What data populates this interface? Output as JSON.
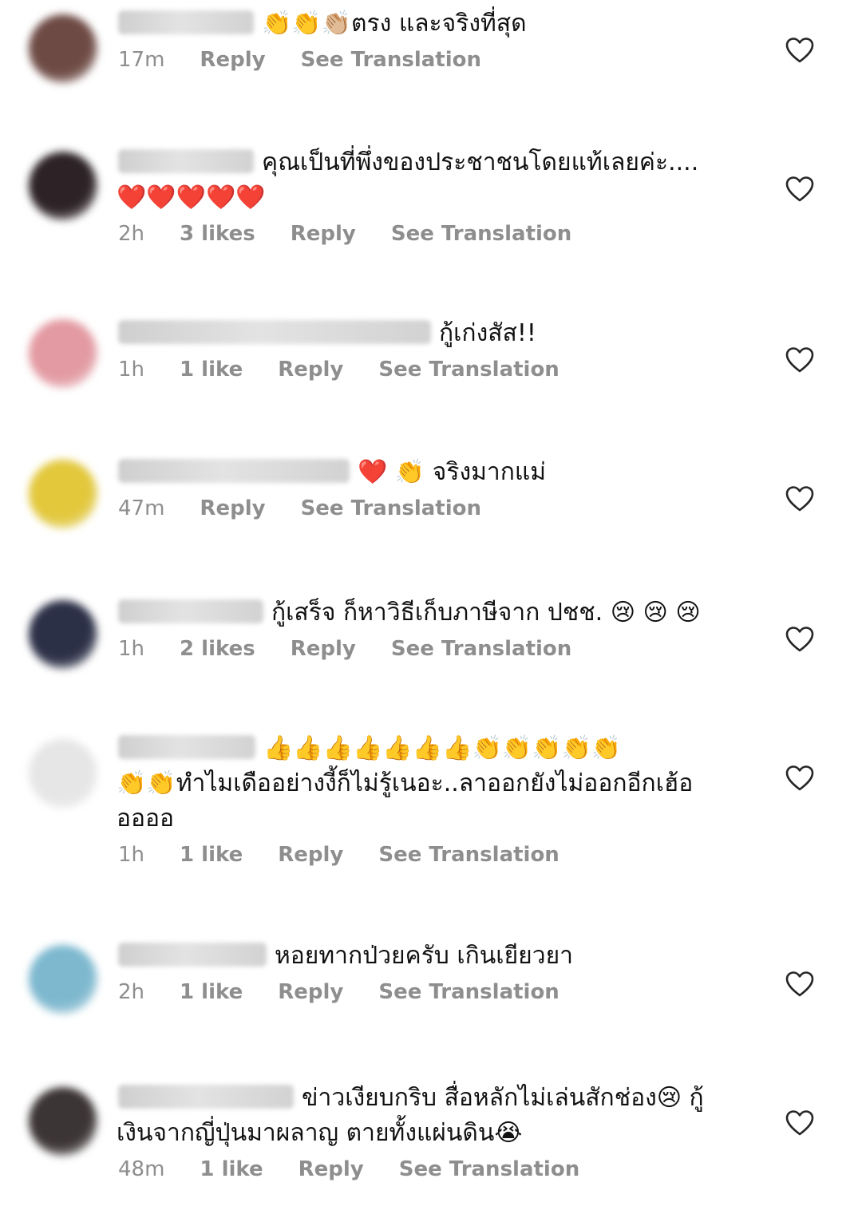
{
  "comments": [
    {
      "text_lines": [
        "👏👏👏🏼ตรง และจริงที่สุด"
      ],
      "time": "17m",
      "likes": "",
      "reply_label": "Reply",
      "translate_label": "See Translation",
      "avatar_color": "#6e4a44"
    },
    {
      "text_lines": [
        "คุณเป็นที่พึ่งของประชาชนโดยแท้เลยค่ะ....",
        "❤️❤️❤️❤️❤️"
      ],
      "time": "2h",
      "likes": "3 likes",
      "reply_label": "Reply",
      "translate_label": "See Translation",
      "avatar_color": "#2d2326"
    },
    {
      "text_lines": [
        "กู้เก่งสัส!!"
      ],
      "time": "1h",
      "likes": "1 like",
      "reply_label": "Reply",
      "translate_label": "See Translation",
      "avatar_color": "#e39aa2"
    },
    {
      "text_lines": [
        "❤️ 👏 จริงมากแม่"
      ],
      "time": "47m",
      "likes": "",
      "reply_label": "Reply",
      "translate_label": "See Translation",
      "avatar_color": "#e3c83c"
    },
    {
      "text_lines": [
        "กู้เสร็จ ก็หาวิธีเก็บภาษีจาก ปชช. 😢 😢 😢"
      ],
      "time": "1h",
      "likes": "2 likes",
      "reply_label": "Reply",
      "translate_label": "See Translation",
      "avatar_color": "#2c3047"
    },
    {
      "text_lines": [
        "👍👍👍👍👍👍👍👏👏👏👏👏",
        "👏👏ทำไมเดืออย่างงี้ก็ไม่รู้เนอะ..ลาออกยังไม่ออกอีกเฮ้อ",
        "ออออ"
      ],
      "time": "1h",
      "likes": "1 like",
      "reply_label": "Reply",
      "translate_label": "See Translation",
      "avatar_color": "#e6e6e6"
    },
    {
      "text_lines": [
        "หอยทากป่วยครับ เกินเยียวยา"
      ],
      "time": "2h",
      "likes": "1 like",
      "reply_label": "Reply",
      "translate_label": "See Translation",
      "avatar_color": "#7db8cf"
    },
    {
      "text_lines": [
        "ข่าวเงียบกริบ สื่อหลักไม่เล่นสักช่อง😢 กู้",
        "เงินจากญี่ปุ่นมาผลาญ ตายทั้งแผ่นดิน😭"
      ],
      "time": "48m",
      "likes": "1 like",
      "reply_label": "Reply",
      "translate_label": "See Translation",
      "avatar_color": "#3c3535"
    }
  ],
  "colors": {
    "meta_text": "#8e8e8e",
    "body_text": "#111111",
    "heart_stroke": "#262626"
  },
  "icons": {
    "like": "heart-outline-icon"
  }
}
